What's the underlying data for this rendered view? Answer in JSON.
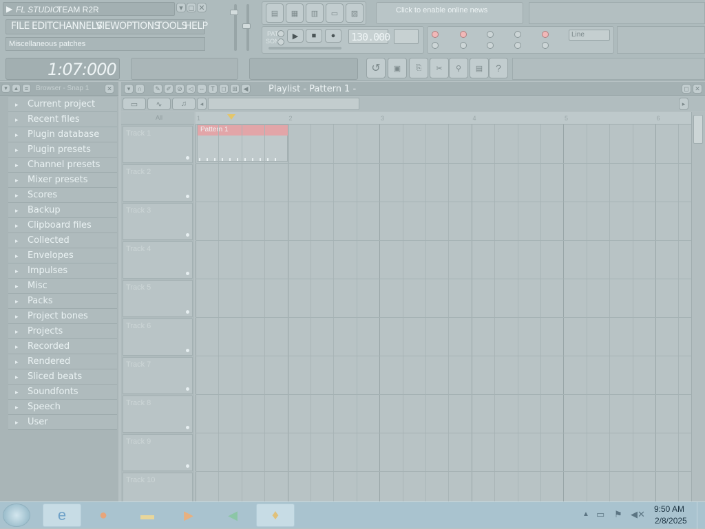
{
  "app": {
    "logo_text": "FL STUDIO",
    "registration": "TEAM R2R",
    "menu": [
      "FILE",
      "EDIT",
      "CHANNELS",
      "VIEW",
      "OPTIONS",
      "TOOLS",
      "HELP"
    ],
    "hint": "Miscellaneous patches",
    "news": "Click to enable online news",
    "time_display": "1:07:000",
    "tempo": "130.000",
    "snap": "Line"
  },
  "browser": {
    "title": "Browser - Snap 1",
    "items": [
      {
        "label": "Current project",
        "icon": "folder-icon"
      },
      {
        "label": "Recent files",
        "icon": "folder-icon"
      },
      {
        "label": "Plugin database",
        "icon": "folder-icon"
      },
      {
        "label": "Plugin presets",
        "icon": "folder-icon"
      },
      {
        "label": "Channel presets",
        "icon": "folder-icon"
      },
      {
        "label": "Mixer presets",
        "icon": "folder-icon"
      },
      {
        "label": "Scores",
        "icon": "folder-icon"
      },
      {
        "label": "Backup",
        "icon": "folder-icon"
      },
      {
        "label": "Clipboard files",
        "icon": "folder-icon"
      },
      {
        "label": "Collected",
        "icon": "folder-icon"
      },
      {
        "label": "Envelopes",
        "icon": "folder-icon"
      },
      {
        "label": "Impulses",
        "icon": "folder-icon"
      },
      {
        "label": "Misc",
        "icon": "folder-icon"
      },
      {
        "label": "Packs",
        "icon": "folder-icon"
      },
      {
        "label": "Project bones",
        "icon": "folder-icon"
      },
      {
        "label": "Projects",
        "icon": "folder-icon"
      },
      {
        "label": "Recorded",
        "icon": "folder-icon"
      },
      {
        "label": "Rendered",
        "icon": "folder-icon"
      },
      {
        "label": "Sliced beats",
        "icon": "folder-icon"
      },
      {
        "label": "Soundfonts",
        "icon": "folder-icon"
      },
      {
        "label": "Speech",
        "icon": "folder-icon"
      },
      {
        "label": "User",
        "icon": "folder-icon"
      }
    ]
  },
  "playlist": {
    "title": "Playlist - Pattern 1 -",
    "bars": [
      "1",
      "2",
      "3",
      "4",
      "5",
      "6"
    ],
    "pattern_clip": "Pattern 1",
    "tracks": [
      "Track 1",
      "Track 2",
      "Track 3",
      "Track 4",
      "Track 5",
      "Track 6",
      "Track 7",
      "Track 8",
      "Track 9",
      "Track 10"
    ]
  },
  "taskbar": {
    "time": "9:50 AM",
    "date": "2/8/2025"
  },
  "colors": {
    "pattern_clip": "#e2a5a8",
    "taskbar": "#a9c3cf"
  }
}
